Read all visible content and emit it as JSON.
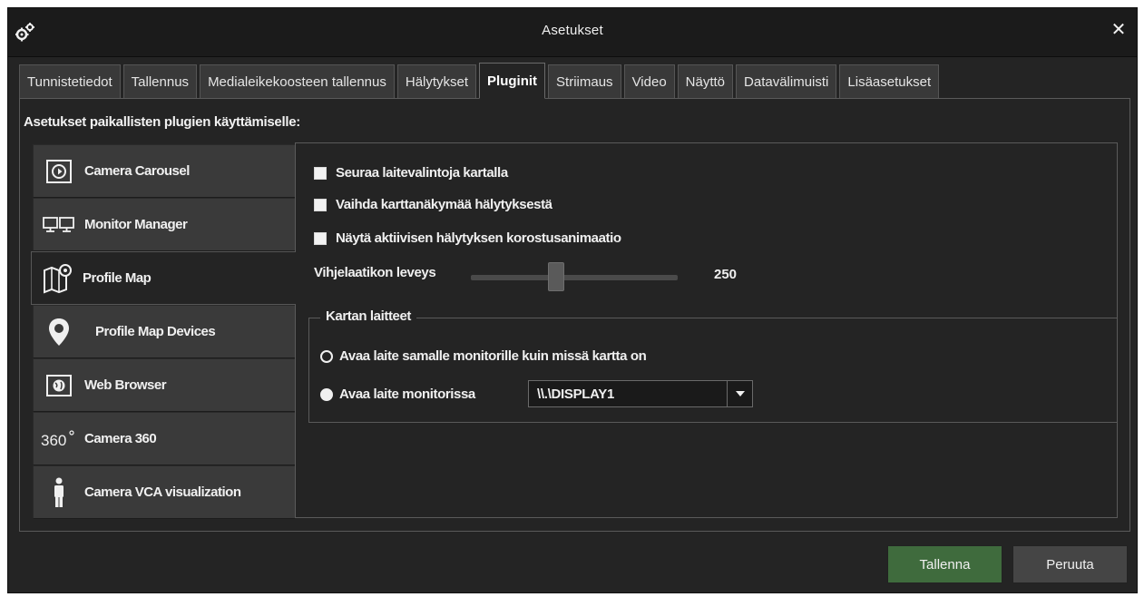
{
  "window": {
    "title": "Asetukset",
    "title_icon": "gears-icon",
    "close_icon": "close-icon",
    "close_glyph": "✕"
  },
  "tabs": [
    {
      "label": "Tunnistetiedot",
      "active": false
    },
    {
      "label": "Tallennus",
      "active": false
    },
    {
      "label": "Medialeikekoosteen tallennus",
      "active": false
    },
    {
      "label": "Hälytykset",
      "active": false
    },
    {
      "label": "Pluginit",
      "active": true
    },
    {
      "label": "Striimaus",
      "active": false
    },
    {
      "label": "Video",
      "active": false
    },
    {
      "label": "Näyttö",
      "active": false
    },
    {
      "label": "Datavälimuisti",
      "active": false
    },
    {
      "label": "Lisäasetukset",
      "active": false
    }
  ],
  "panel": {
    "heading": "Asetukset paikallisten plugien käyttämiselle:"
  },
  "plugins": [
    {
      "label": "Camera Carousel",
      "icon": "carousel-icon",
      "active": false
    },
    {
      "label": "Monitor Manager",
      "icon": "monitors-icon",
      "active": false
    },
    {
      "label": "Profile Map",
      "icon": "map-icon",
      "active": true
    },
    {
      "label": "Profile Map Devices",
      "icon": "map-pin-icon",
      "active": false
    },
    {
      "label": "Web Browser",
      "icon": "globe-icon",
      "active": false
    },
    {
      "label": "Camera 360",
      "icon": "camera-360-icon",
      "active": false
    },
    {
      "label": "Camera VCA visualization",
      "icon": "person-icon",
      "active": false
    }
  ],
  "settings": {
    "options": [
      {
        "label": "Seuraa laitevalintoja kartalla",
        "checked": false
      },
      {
        "label": "Vaihda karttanäkymää hälytyksestä",
        "checked": false
      },
      {
        "label": "Näytä aktiivisen hälytyksen korostusanimaatio",
        "checked": false
      }
    ],
    "slider": {
      "label": "Vihjelaatikon leveys",
      "value": "250"
    },
    "group": {
      "legend": "Kartan laitteet",
      "radio_same": {
        "label": "Avaa laite samalle monitorille kuin missä kartta on",
        "checked": false
      },
      "radio_monitor": {
        "label": "Avaa laite monitorissa",
        "checked": true
      },
      "monitor_select": {
        "value": "\\\\.\\DISPLAY1"
      }
    }
  },
  "footer": {
    "save_label": "Tallenna",
    "cancel_label": "Peruuta"
  },
  "colors": {
    "background": "#242424",
    "titlebar": "#1b1b1b",
    "save_button": "#3f6b3d",
    "cancel_button": "#454545"
  }
}
